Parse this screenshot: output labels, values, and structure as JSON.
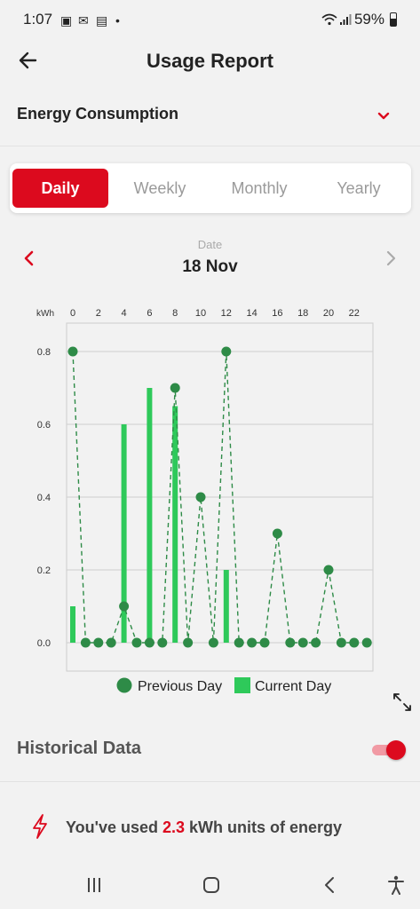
{
  "status": {
    "time": "1:07",
    "battery": "59%"
  },
  "header": {
    "title": "Usage Report"
  },
  "section": {
    "label": "Energy Consumption"
  },
  "tabs": [
    {
      "label": "Daily",
      "active": true
    },
    {
      "label": "Weekly",
      "active": false
    },
    {
      "label": "Monthly",
      "active": false
    },
    {
      "label": "Yearly",
      "active": false
    }
  ],
  "date": {
    "caption": "Date",
    "value": "18 Nov"
  },
  "chart_data": {
    "type": "bar",
    "y_unit_label": "kWh",
    "x": [
      0,
      1,
      2,
      3,
      4,
      5,
      6,
      7,
      8,
      9,
      10,
      11,
      12,
      13,
      14,
      15,
      16,
      17,
      18,
      19,
      20,
      21,
      22,
      23
    ],
    "x_tick_labels": [
      "0",
      "2",
      "4",
      "6",
      "8",
      "10",
      "12",
      "14",
      "16",
      "18",
      "20",
      "22"
    ],
    "y_ticks": [
      "0.0",
      "0.2",
      "0.4",
      "0.6",
      "0.8"
    ],
    "ylim": [
      0,
      0.8
    ],
    "legend_position": "bottom",
    "series": [
      {
        "name": "Previous Day",
        "style": "dashed-line-markers",
        "color": "#2e8b47",
        "values": [
          0.8,
          0,
          0,
          0,
          0.1,
          0,
          0,
          0,
          0.7,
          0,
          0.4,
          0,
          0.8,
          0,
          0,
          0,
          0.3,
          0,
          0,
          0,
          0.2,
          0,
          0,
          0
        ]
      },
      {
        "name": "Current Day",
        "style": "bar",
        "color": "#2ec95a",
        "values": [
          0.1,
          0,
          0,
          0,
          0.6,
          0,
          0.7,
          0,
          0.65,
          0,
          0,
          0,
          0.2,
          0,
          0,
          0,
          0,
          0,
          0,
          0,
          0,
          0,
          0,
          0
        ]
      }
    ]
  },
  "historical": {
    "label": "Historical Data",
    "enabled": true
  },
  "summary": {
    "prefix": "You've used ",
    "value": "2.3",
    "suffix": " kWh units of energy"
  },
  "colors": {
    "accent": "#dc0a1e"
  }
}
